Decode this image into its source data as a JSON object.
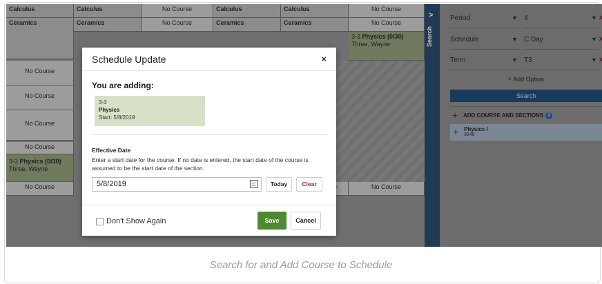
{
  "grid": {
    "row1": [
      "Calculus",
      "Calculus",
      "No Course",
      "Calculus",
      "Calculus",
      "No Course"
    ],
    "row2": [
      "Ceramics",
      "Ceramics",
      "No Course",
      "Ceramics",
      "Ceramics",
      "No Course"
    ],
    "right_course": {
      "code": "3-3",
      "name": "Physics (0/30)",
      "teacher": "Three, Wayne"
    },
    "left_no_course": [
      "No Course",
      "No Course",
      "No Course",
      "No Course"
    ],
    "left_course": {
      "code": "3-3",
      "name": "Physics (0/30)",
      "teacher": "Three, Wayne"
    },
    "bottom_row": [
      "No Course",
      "No Course"
    ],
    "partial_e": "e"
  },
  "search_tab": {
    "label": "Search",
    "chevron": ">"
  },
  "filters": [
    {
      "label": "Period",
      "value": "4"
    },
    {
      "label": "Schedule",
      "value": "C Day"
    },
    {
      "label": "Term",
      "value": "T3"
    }
  ],
  "add_option": "+ Add Option",
  "search_button": "Search",
  "add_course_sections": "ADD COURSE AND SECTIONS",
  "result": {
    "name": "Physics I",
    "number": "3848"
  },
  "modal": {
    "title": "Schedule Update",
    "close": "×",
    "adding_heading": "You are adding:",
    "card": {
      "section": "3-3",
      "course": "Physics",
      "start": "Start: 5/8/2019"
    },
    "effective_date_label": "Effective Date",
    "help_text": "Enter a start date for the course. If no date is entered, the start date of the course is assumed to be the start date of the section.",
    "date_value": "5/8/2019",
    "today_label": "Today",
    "clear_label": "Clear",
    "dont_show_label": "Don't Show Again",
    "save_label": "Save",
    "cancel_label": "Cancel"
  },
  "caption": "Search for and Add Course to Schedule"
}
